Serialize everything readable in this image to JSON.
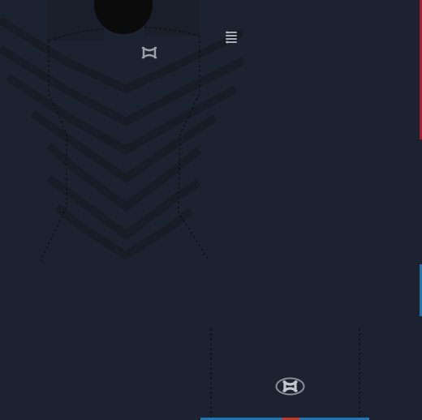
{
  "template": {
    "kind": "uv-texture",
    "background_color": "#1d2230",
    "collar_color": "#0b0b0c",
    "shoulder_color": "#1a1e2a",
    "stitch_color": "#0a0c12",
    "chevron_color": "#181c27"
  },
  "logos": {
    "chest": {
      "icon": "under-armour-logo-icon",
      "color": "#9aa0aa"
    },
    "back": {
      "icon": "under-armour-oval-logo-icon",
      "color": "#8a8f99"
    },
    "tag": {
      "icon": "size-tag-icon",
      "color": "#a9adb5"
    }
  },
  "edge_stripes": [
    {
      "name": "red-edge-stripe",
      "color": "#b0182c"
    },
    {
      "name": "blue-edge-stripe",
      "color": "#1d73b3"
    }
  ],
  "bottom_band": {
    "colors": [
      "#2275b5",
      "#c0392b",
      "#2275b5"
    ]
  }
}
